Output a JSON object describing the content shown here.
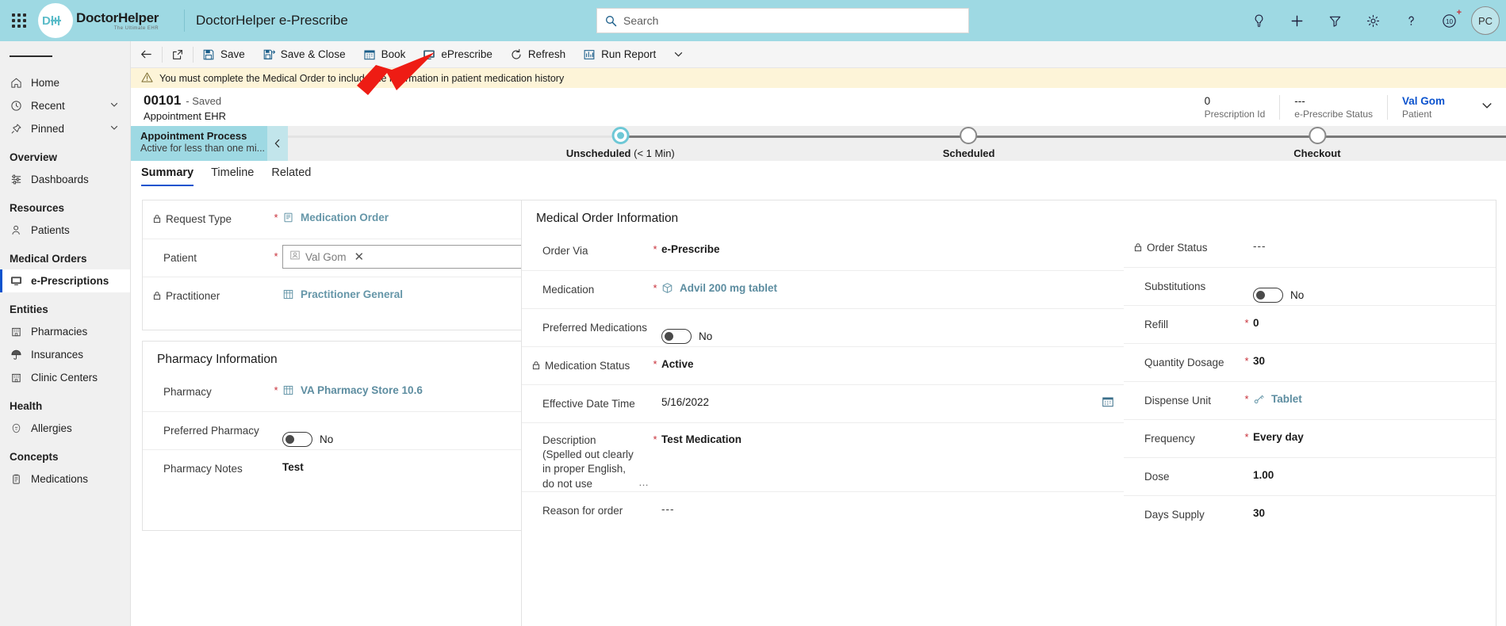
{
  "topnav": {
    "waffle_icon": "app-launcher-icon",
    "logo_initials": "DH",
    "brand_name": "DoctorHelper",
    "brand_tagline": "The Ultimate EHR",
    "app_name": "DoctorHelper e-Prescribe",
    "search_placeholder": "Search",
    "icons": [
      {
        "name": "insights-lightbulb-icon",
        "glyph": "lightbulb"
      },
      {
        "name": "quick-create-icon",
        "glyph": "plus"
      },
      {
        "name": "filter-icon",
        "glyph": "funnel"
      },
      {
        "name": "settings-gear-icon",
        "glyph": "gear"
      },
      {
        "name": "help-icon",
        "glyph": "question"
      },
      {
        "name": "trial-days-icon",
        "glyph": "10+"
      }
    ],
    "avatar_initials": "PC"
  },
  "sidebar": {
    "hamburger": "site-map-toggle",
    "items": [
      {
        "label": "Home",
        "icon": "home-icon",
        "chevron": false
      },
      {
        "label": "Recent",
        "icon": "clock-icon",
        "chevron": true
      },
      {
        "label": "Pinned",
        "icon": "pin-icon",
        "chevron": true
      }
    ],
    "groups": [
      {
        "title": "Overview",
        "items": [
          {
            "label": "Dashboards",
            "icon": "dashboard-icon",
            "selected": false
          }
        ]
      },
      {
        "title": "Resources",
        "items": [
          {
            "label": "Patients",
            "icon": "patient-icon",
            "selected": false
          }
        ]
      },
      {
        "title": "Medical Orders",
        "items": [
          {
            "label": "e-Prescriptions",
            "icon": "eprescribe-icon",
            "selected": true
          }
        ]
      },
      {
        "title": "Entities",
        "items": [
          {
            "label": "Pharmacies",
            "icon": "pharmacy-icon",
            "selected": false
          },
          {
            "label": "Insurances",
            "icon": "umbrella-icon",
            "selected": false
          },
          {
            "label": "Clinic Centers",
            "icon": "clinic-icon",
            "selected": false
          }
        ]
      },
      {
        "title": "Health",
        "items": [
          {
            "label": "Allergies",
            "icon": "allergy-icon",
            "selected": false
          }
        ]
      },
      {
        "title": "Concepts",
        "items": [
          {
            "label": "Medications",
            "icon": "medication-icon",
            "selected": false
          }
        ]
      }
    ]
  },
  "commandbar": {
    "back_icon": "back-arrow-icon",
    "popout_icon": "open-in-new-window-icon",
    "buttons": [
      {
        "label": "Save",
        "icon": "save-icon"
      },
      {
        "label": "Save & Close",
        "icon": "save-and-close-icon"
      },
      {
        "label": "Book",
        "icon": "calendar-icon"
      },
      {
        "label": "ePrescribe",
        "icon": "eprescribe-icon"
      },
      {
        "label": "Refresh",
        "icon": "refresh-icon"
      },
      {
        "label": "Run Report",
        "icon": "report-icon"
      }
    ],
    "overflow_icon": "chevron-down-icon"
  },
  "notification": {
    "icon": "warning-icon",
    "text": "You must complete the Medical Order to include the information in patient medication history"
  },
  "record_header": {
    "number": "00101",
    "state": "- Saved",
    "entity": "Appointment EHR",
    "fields": [
      {
        "value": "0",
        "label": "Prescription Id",
        "link": false
      },
      {
        "value": "---",
        "label": "e-Prescribe Status",
        "link": false
      },
      {
        "value": "Val Gom",
        "label": "Patient",
        "link": true
      }
    ],
    "expand_icon": "chevron-down-icon"
  },
  "process_flow": {
    "name": "Appointment Process",
    "status": "Active for less than one mi...",
    "collapse_icon": "chevron-left-icon",
    "stages": [
      {
        "label": "Unscheduled",
        "duration": "(< 1 Min)",
        "active": true
      },
      {
        "label": "Scheduled",
        "duration": "",
        "active": false
      },
      {
        "label": "Checkout",
        "duration": "",
        "active": false
      }
    ]
  },
  "tabs": [
    {
      "label": "Summary",
      "active": true
    },
    {
      "label": "Timeline",
      "active": false
    },
    {
      "label": "Related",
      "active": false
    }
  ],
  "request_card": {
    "rows": [
      {
        "label": "Request Type",
        "locked": true,
        "required": true,
        "value": "Medication Order",
        "type": "lookup-link",
        "icon": "medication-order-icon"
      },
      {
        "label": "Patient",
        "locked": false,
        "required": true,
        "value": "Val Gom",
        "type": "lookup-input",
        "icon": "contact-icon",
        "clear_icon": "close-icon",
        "search_icon": "search-icon"
      },
      {
        "label": "Practitioner",
        "locked": true,
        "required": false,
        "value": "Practitioner General",
        "type": "lookup-link",
        "icon": "entity-icon"
      }
    ]
  },
  "pharmacy_card": {
    "title": "Pharmacy Information",
    "rows": [
      {
        "label": "Pharmacy",
        "locked": false,
        "required": true,
        "value": "VA Pharmacy Store 10.6",
        "type": "lookup-link",
        "icon": "entity-icon"
      },
      {
        "label": "Preferred Pharmacy",
        "locked": false,
        "required": false,
        "value": "No",
        "type": "toggle"
      },
      {
        "label": "Pharmacy Notes",
        "locked": false,
        "required": false,
        "value": "Test",
        "type": "text"
      }
    ]
  },
  "medical_order_card": {
    "title": "Medical Order Information",
    "rows": [
      {
        "label": "Order Via",
        "locked": false,
        "required": true,
        "value": "e-Prescribe",
        "type": "text"
      },
      {
        "label": "Medication",
        "locked": false,
        "required": true,
        "value": "Advil 200 mg tablet",
        "type": "lookup-link",
        "icon": "medication-icon"
      },
      {
        "label": "Preferred Medications",
        "locked": false,
        "required": false,
        "value": "No",
        "type": "toggle"
      },
      {
        "label": "Medication Status",
        "locked": true,
        "required": true,
        "value": "Active",
        "type": "text"
      },
      {
        "label": "Effective Date Time",
        "locked": false,
        "required": false,
        "value": "5/16/2022",
        "type": "date",
        "icon": "calendar-icon"
      },
      {
        "label": "Description (Spelled out clearly in proper English, do not use",
        "locked": false,
        "required": true,
        "value": "Test Medication",
        "type": "text",
        "truncated": true
      },
      {
        "label": "Reason for order",
        "locked": false,
        "required": false,
        "value": "---",
        "type": "dash"
      }
    ]
  },
  "dosage_card": {
    "rows": [
      {
        "label": "Order Status",
        "locked": true,
        "required": false,
        "value": "---",
        "type": "dash"
      },
      {
        "label": "Substitutions",
        "locked": false,
        "required": false,
        "value": "No",
        "type": "toggle"
      },
      {
        "label": "Refill",
        "locked": false,
        "required": true,
        "value": "0",
        "type": "text"
      },
      {
        "label": "Quantity Dosage",
        "locked": false,
        "required": true,
        "value": "30",
        "type": "text"
      },
      {
        "label": "Dispense Unit",
        "locked": false,
        "required": true,
        "value": "Tablet",
        "type": "lookup-link",
        "icon": "unit-icon"
      },
      {
        "label": "Frequency",
        "locked": false,
        "required": true,
        "value": "Every day",
        "type": "text"
      },
      {
        "label": "Dose",
        "locked": false,
        "required": false,
        "value": "1.00",
        "type": "text"
      },
      {
        "label": "Days Supply",
        "locked": false,
        "required": false,
        "value": "30",
        "type": "text"
      }
    ]
  },
  "annotation": {
    "arrow_color": "#ee1c14",
    "points_to": "ePrescribe"
  },
  "colors": {
    "brand_teal": "#9ed9e3",
    "link_blue": "#0b53ce",
    "required_red": "#c8303a",
    "warning_bg": "#fdf4d8"
  }
}
